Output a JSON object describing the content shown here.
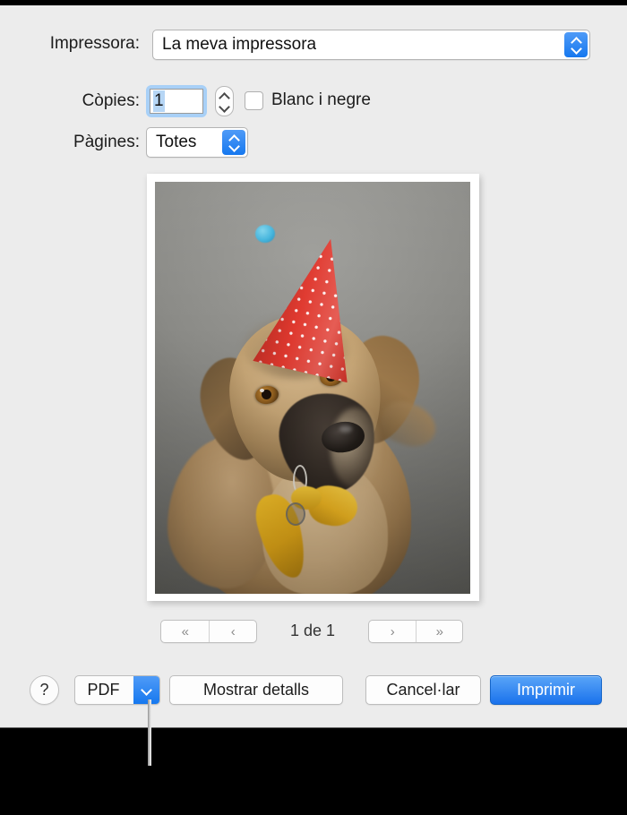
{
  "dialog": {
    "printer_row": {
      "label": "Impressora:",
      "selected_value": "La meva impressora",
      "arrow_icon": "chevron-up-down-icon"
    },
    "copies_row": {
      "label": "Còpies:",
      "value": "1",
      "stepper_icon": "stepper-up-down-icon",
      "checkbox": {
        "label": "Blanc i negre",
        "checked": false
      }
    },
    "pages_row": {
      "label": "Pàgines:",
      "selected_value": "Totes",
      "arrow_icon": "chevron-up-down-icon"
    },
    "preview": {
      "description": "Fotografia d'un gos amb barret de festa",
      "alt": "dog-with-party-hat-photo"
    },
    "navigation": {
      "first_label": "«",
      "prev_label": "‹",
      "next_label": "›",
      "last_label": "»",
      "page_indicator": "1 de 1"
    },
    "footer": {
      "help_label": "?",
      "pdf_label": "PDF",
      "pdf_arrow_icon": "chevron-down-icon",
      "details_label": "Mostrar detalls",
      "cancel_label": "Cancel·lar",
      "print_label": "Imprimir"
    },
    "colors": {
      "accent_blue": "#1a72ec",
      "panel_background": "#ececec",
      "focus_ring": "#a8d0f7",
      "selection": "#b6d6f5"
    }
  }
}
